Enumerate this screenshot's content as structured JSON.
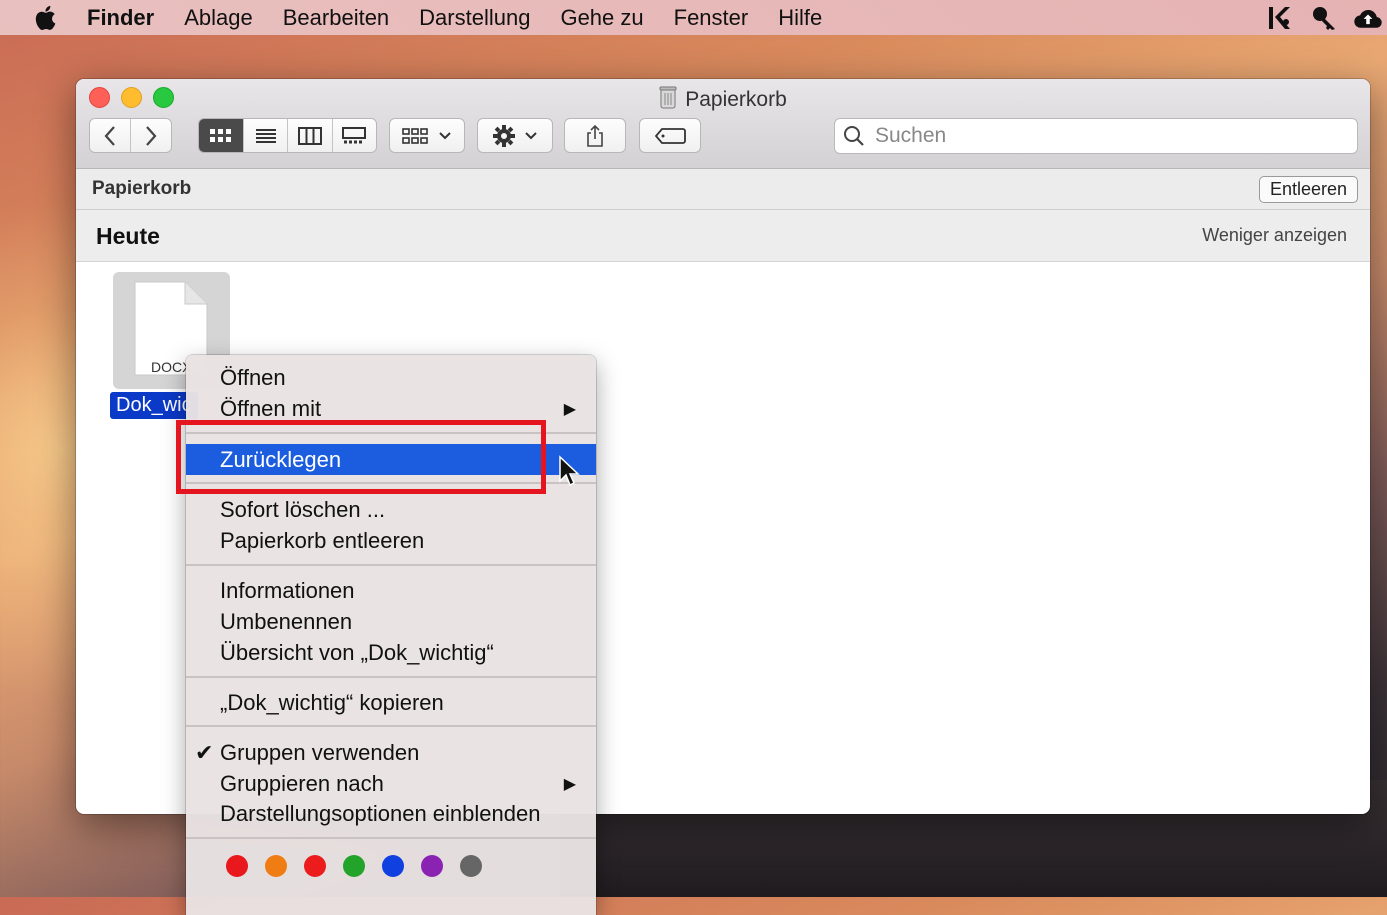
{
  "menubar": {
    "app_name": "Finder",
    "items": [
      "Ablage",
      "Bearbeiten",
      "Darstellung",
      "Gehe zu",
      "Fenster",
      "Hilfe"
    ],
    "right_icons": [
      "kaspersky-icon",
      "keychain-key-icon",
      "cloud-upload-icon"
    ]
  },
  "window": {
    "title": "Papierkorb",
    "search_placeholder": "Suchen",
    "location": "Papierkorb",
    "empty_button": "Entleeren",
    "group_title": "Heute",
    "show_less": "Weniger anzeigen",
    "file": {
      "extension": "DOCX",
      "name_visible": "Dok_wic"
    }
  },
  "context_menu": {
    "items": [
      {
        "label": "Öffnen"
      },
      {
        "label": "Öffnen mit",
        "submenu": true
      },
      {
        "label": "Zurücklegen",
        "selected": true
      },
      {
        "label": "Sofort löschen ..."
      },
      {
        "label": "Papierkorb entleeren"
      },
      {
        "label": "Informationen"
      },
      {
        "label": "Umbenennen"
      },
      {
        "label": "Übersicht von „Dok_wichtig“"
      },
      {
        "label": "„Dok_wichtig“ kopieren"
      },
      {
        "label": "Gruppen verwenden",
        "checked": true
      },
      {
        "label": "Gruppieren nach",
        "submenu": true
      },
      {
        "label": "Darstellungsoptionen einblenden"
      }
    ],
    "tag_colors": [
      "#e8181c",
      "#f07d13",
      "#ec1c1c",
      "#22a32a",
      "#1140e0",
      "#8a23b2",
      "#666666"
    ]
  },
  "colors": {
    "selection": "#1c5de0",
    "annotation_box": "#e5151f"
  }
}
